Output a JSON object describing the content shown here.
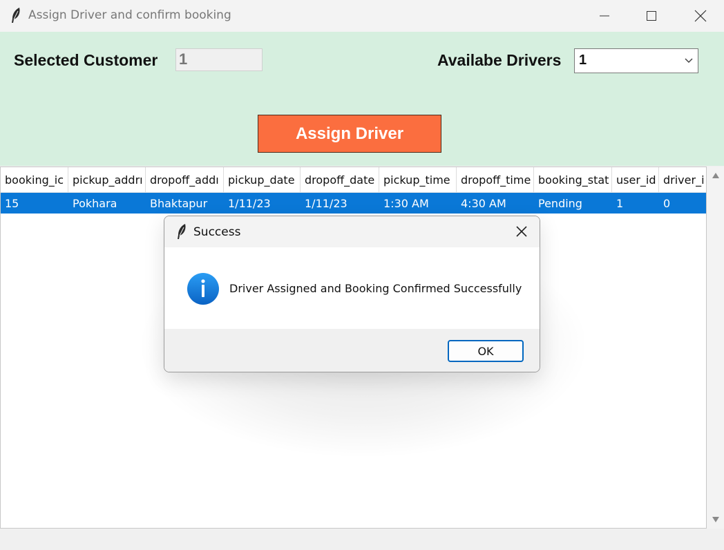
{
  "window": {
    "title": "Assign Driver and confirm booking"
  },
  "form": {
    "customer_label": "Selected Customer",
    "customer_value": "1",
    "drivers_label": "Availabe Drivers",
    "drivers_selected": "1",
    "assign_button": "Assign Driver"
  },
  "table": {
    "columns": [
      "booking_ic",
      "pickup_addrı",
      "dropoff_addı",
      "pickup_date",
      "dropoff_date",
      "pickup_time",
      "dropoff_time",
      "booking_stat",
      "user_id",
      "driver_i"
    ],
    "rows": [
      [
        "15",
        "Pokhara",
        "Bhaktapur",
        "1/11/23",
        "1/11/23",
        "1:30 AM",
        "4:30 AM",
        "Pending",
        "1",
        "0"
      ]
    ]
  },
  "dialog": {
    "title": "Success",
    "message": "Driver Assigned and Booking Confirmed Successfully",
    "ok_label": "OK",
    "icon": "info-icon"
  },
  "colors": {
    "top_panel_bg": "#d6efdf",
    "assign_button_bg": "#fb6e3f",
    "row_selected_bg": "#0a78d7",
    "dialog_ok_border": "#0067c0"
  }
}
